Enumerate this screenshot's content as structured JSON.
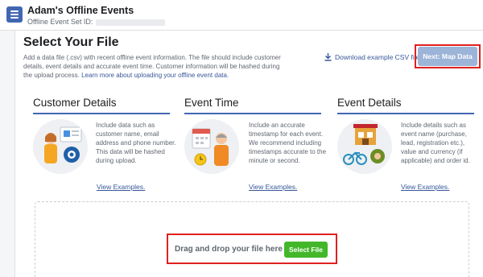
{
  "header": {
    "title": "Adam's Offline Events",
    "subtitle": "Offline Event Set ID:"
  },
  "main": {
    "section_title": "Select Your File",
    "intro_text": "Add a data file (.csv) with recent offline event information. The file should include customer details, event details and accurate event time. Customer information will be hashed during the upload process.",
    "learn_more": "Learn more about uploading your offline event data.",
    "download_label": "Download example CSV file",
    "next_button": "Next: Map Data"
  },
  "columns": [
    {
      "title": "Customer Details",
      "description": "Include data such as customer name, email address and phone number. This data will be hashed during upload.",
      "link": "View Examples."
    },
    {
      "title": "Event Time",
      "description": "Include an accurate timestamp for each event. We recommend including timestamps accurate to the minute or second.",
      "link": "View Examples."
    },
    {
      "title": "Event Details",
      "description": "Include details such as event name (purchase, lead, registration etc.), value and currency (if applicable) and order id.",
      "link": "View Examples."
    }
  ],
  "dropzone": {
    "text": "Drag and drop your file here or",
    "button": "Select File"
  },
  "colors": {
    "accent": "#4267b2",
    "link": "#385898",
    "select_button": "#42b72a",
    "next_button_disabled": "#9cb4d8",
    "highlight": "#e02020"
  },
  "icons": [
    "app-icon",
    "download-icon",
    "customer-illustration",
    "event-time-illustration",
    "event-details-illustration"
  ]
}
